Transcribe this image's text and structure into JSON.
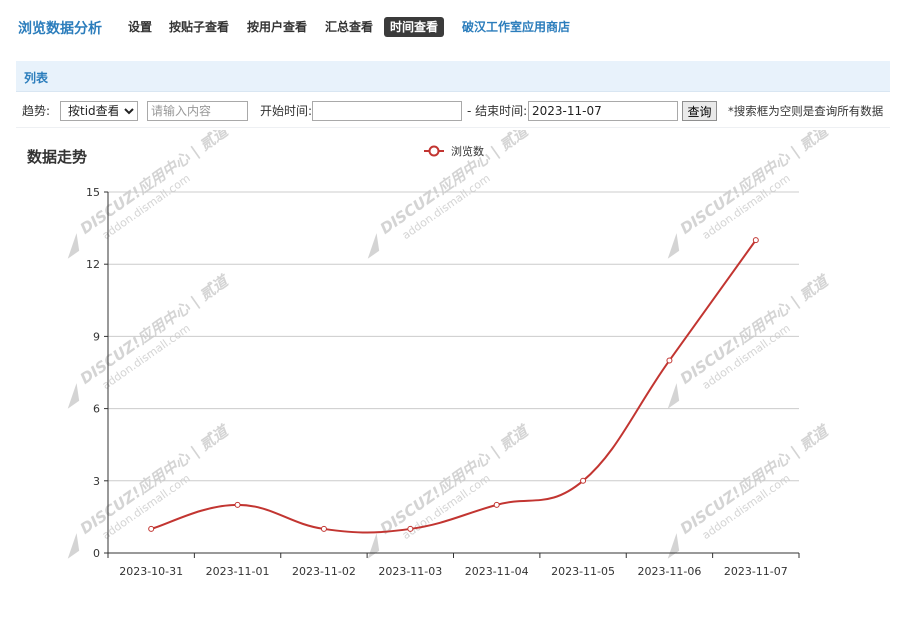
{
  "app": {
    "title": "浏览数据分析"
  },
  "nav": {
    "items": [
      {
        "label": "设置",
        "name": "nav-settings",
        "active": false,
        "store": false
      },
      {
        "label": "按贴子查看",
        "name": "nav-by-thread",
        "active": false,
        "store": false
      },
      {
        "label": "按用户查看",
        "name": "nav-by-user",
        "active": false,
        "store": false
      },
      {
        "label": "汇总查看",
        "name": "nav-summary",
        "active": false,
        "store": false
      },
      {
        "label": "时间查看",
        "name": "nav-by-time",
        "active": true,
        "store": false
      },
      {
        "label": "破汉工作室应用商店",
        "name": "nav-app-store",
        "active": false,
        "store": true
      }
    ]
  },
  "panel": {
    "title": "列表"
  },
  "filter": {
    "trend_label": "趋势:",
    "trend_selected": "按tid查看",
    "content_placeholder": "请输入内容",
    "content_value": "",
    "start_label": "开始时间:",
    "start_value": "",
    "end_label": "- 结束时间:",
    "end_value": "2023-11-07",
    "query_button": "查询",
    "hint": "*搜索框为空则是查询所有数据"
  },
  "chart_data": {
    "type": "line",
    "title": "数据走势",
    "categories": [
      "2023-10-31",
      "2023-11-01",
      "2023-11-02",
      "2023-11-03",
      "2023-11-04",
      "2023-11-05",
      "2023-11-06",
      "2023-11-07"
    ],
    "series": [
      {
        "name": "浏览数",
        "values": [
          1,
          2,
          1,
          1,
          2,
          3,
          8,
          13
        ],
        "color": "#c23531"
      }
    ],
    "ylim": [
      0,
      15
    ],
    "yticks": [
      0,
      3,
      6,
      9,
      12,
      15
    ],
    "grid": true,
    "legend": "top-center",
    "smooth": true
  },
  "watermark": {
    "brand": "DISCUZ!应用中心 | 贰道",
    "domain": "addon.dismall.com",
    "color": "#d4d4d4"
  }
}
